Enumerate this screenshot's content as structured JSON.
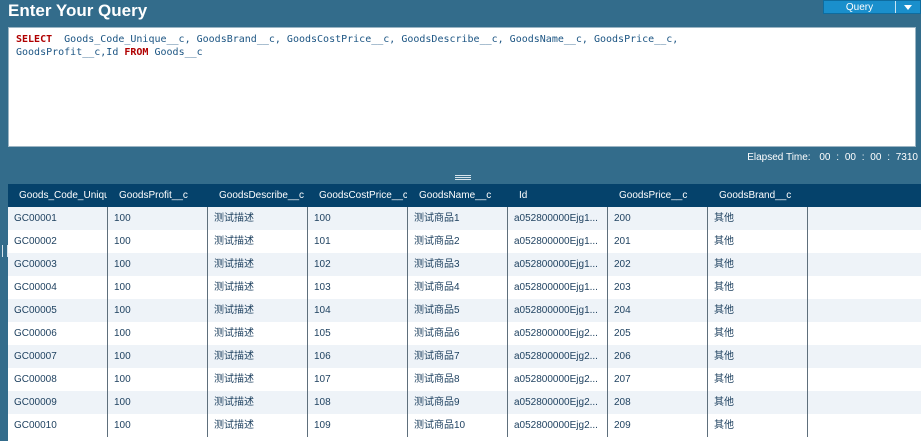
{
  "header": {
    "title": "Enter Your Query",
    "query_button": "Query"
  },
  "editor": {
    "tokens": [
      {
        "t": "SELECT",
        "kw": true
      },
      {
        "t": "  Goods_Code_Unique__c, GoodsBrand__c, GoodsCostPrice__c, GoodsDescribe__c, GoodsName__c, GoodsPrice__c,\nGoodsProfit__c,Id ",
        "kw": false
      },
      {
        "t": "FROM",
        "kw": true
      },
      {
        "t": " Goods__c",
        "kw": false
      }
    ]
  },
  "elapsed": {
    "label": "Elapsed Time:",
    "value": "00 : 00 : 00 : 7310"
  },
  "table": {
    "columns": [
      "Goods_Code_Unique__c",
      "GoodsProfit__c",
      "GoodsDescribe__c",
      "GoodsCostPrice__c",
      "GoodsName__c",
      "Id",
      "GoodsPrice__c",
      "GoodsBrand__c",
      ""
    ],
    "rows": [
      [
        "GC00001",
        "100",
        "测试描述",
        "100",
        "测试商品1",
        "a052800000Ejg1...",
        "200",
        "其他",
        ""
      ],
      [
        "GC00002",
        "100",
        "测试描述",
        "101",
        "测试商品2",
        "a052800000Ejg1...",
        "201",
        "其他",
        ""
      ],
      [
        "GC00003",
        "100",
        "测试描述",
        "102",
        "测试商品3",
        "a052800000Ejg1...",
        "202",
        "其他",
        ""
      ],
      [
        "GC00004",
        "100",
        "测试描述",
        "103",
        "测试商品4",
        "a052800000Ejg1...",
        "203",
        "其他",
        ""
      ],
      [
        "GC00005",
        "100",
        "测试描述",
        "104",
        "测试商品5",
        "a052800000Ejg1...",
        "204",
        "其他",
        ""
      ],
      [
        "GC00006",
        "100",
        "测试描述",
        "105",
        "测试商品6",
        "a052800000Ejg2...",
        "205",
        "其他",
        ""
      ],
      [
        "GC00007",
        "100",
        "测试描述",
        "106",
        "测试商品7",
        "a052800000Ejg2...",
        "206",
        "其他",
        ""
      ],
      [
        "GC00008",
        "100",
        "测试描述",
        "107",
        "测试商品8",
        "a052800000Ejg2...",
        "207",
        "其他",
        ""
      ],
      [
        "GC00009",
        "100",
        "测试描述",
        "108",
        "测试商品9",
        "a052800000Ejg2...",
        "208",
        "其他",
        ""
      ],
      [
        "GC00010",
        "100",
        "测试描述",
        "109",
        "测试商品10",
        "a052800000Ejg2...",
        "209",
        "其他",
        ""
      ]
    ]
  }
}
